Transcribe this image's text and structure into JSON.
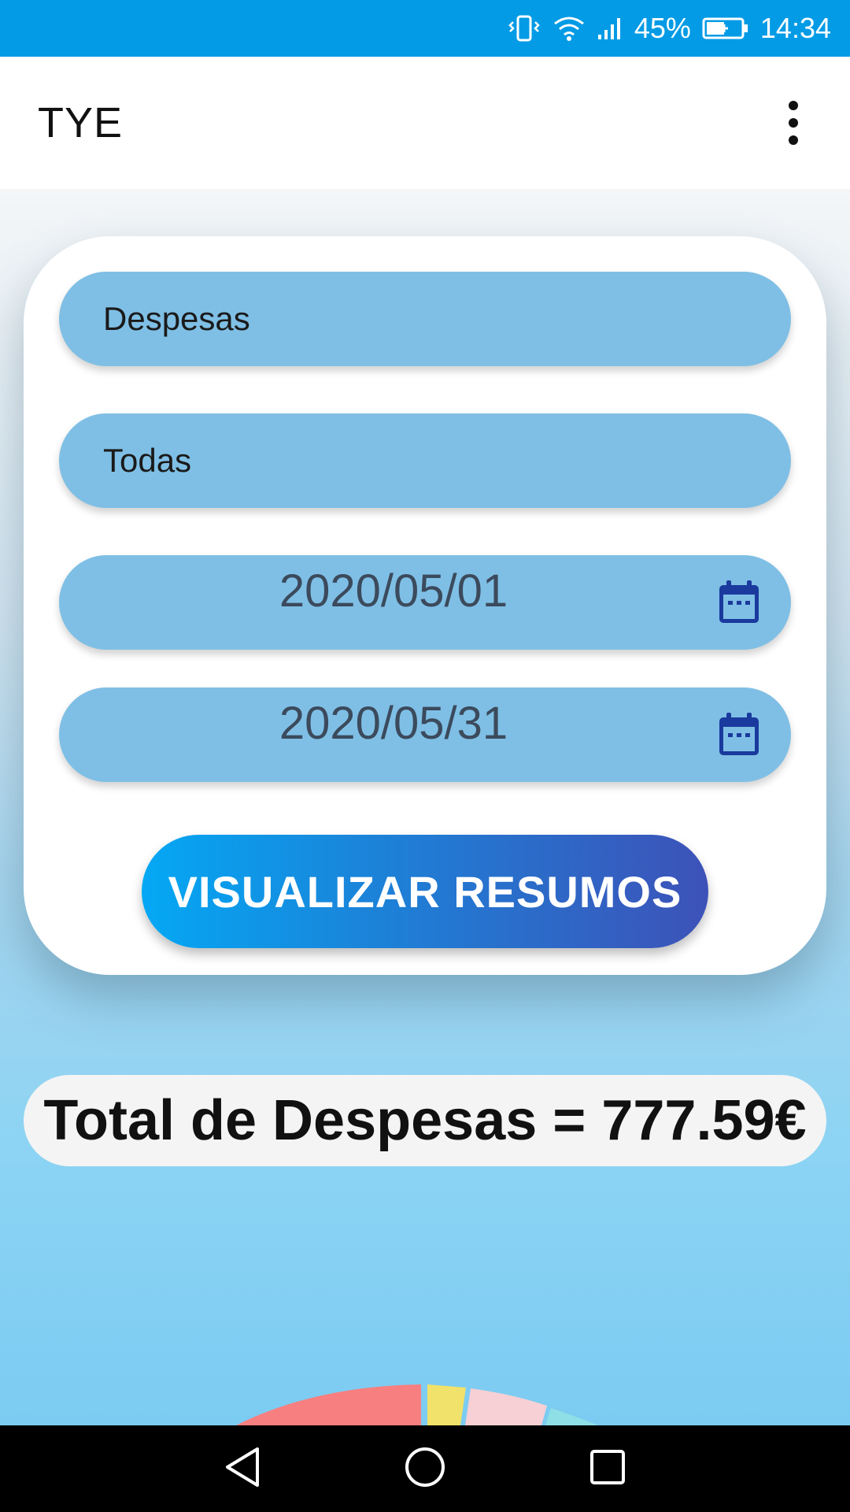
{
  "status_bar": {
    "battery": "45%",
    "time": "14:34"
  },
  "app_bar": {
    "title": "TYE"
  },
  "filters": {
    "type_value": "Despesas",
    "category_value": "Todas",
    "start_date": "2020/05/01",
    "end_date": "2020/05/31"
  },
  "actions": {
    "view_summaries_label": "VISUALIZAR RESUMOS"
  },
  "summary": {
    "total_text": "Total de Despesas = 777.59€"
  },
  "colors": {
    "status_bar": "#039be5",
    "field_bg": "#7fbfe5",
    "button_start": "#04a8f4",
    "button_end": "#3d52b8",
    "calendar_icon": "#1a3a9e",
    "pie_slices": [
      "#f77f7f",
      "#f0e26a",
      "#f6d0d4",
      "#8fe0e6"
    ]
  },
  "icons": {
    "status": [
      "vibrate-icon",
      "wifi-icon",
      "signal-icon",
      "battery-charging-icon"
    ],
    "menu": "more-vertical-icon",
    "date": "calendar-icon",
    "nav": [
      "back-icon",
      "home-icon",
      "recents-icon"
    ]
  }
}
